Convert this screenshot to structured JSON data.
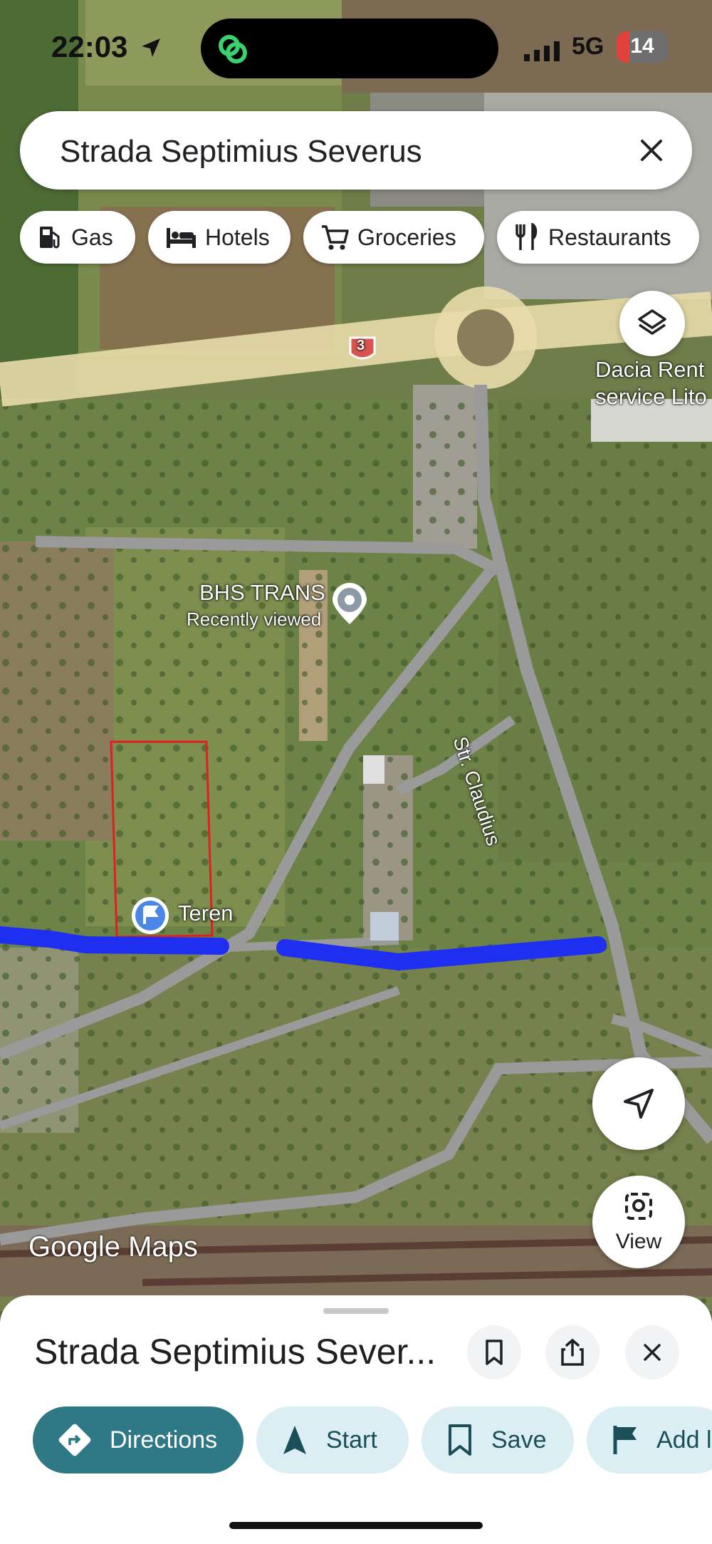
{
  "status_bar": {
    "time": "22:03",
    "network": "5G",
    "battery": "14"
  },
  "search": {
    "value": "Strada Septimius Severus"
  },
  "chips": [
    {
      "label": "Gas",
      "icon": "gas-station-icon"
    },
    {
      "label": "Hotels",
      "icon": "bed-icon"
    },
    {
      "label": "Groceries",
      "icon": "cart-icon"
    },
    {
      "label": "Restaurants",
      "icon": "fork-knife-icon"
    }
  ],
  "map": {
    "route_shield": "3",
    "business_label": "Dacia Rent service Lito",
    "poi": {
      "name": "BHS TRANS",
      "subtitle": "Recently viewed"
    },
    "street_label": "Str. Claudius",
    "marker_label": "Teren",
    "watermark_google": "Google",
    "watermark_maps": "Maps",
    "view_label": "View"
  },
  "sheet": {
    "title": "Strada Septimius Sever...",
    "actions": [
      "Directions",
      "Start",
      "Save",
      "Add l"
    ]
  },
  "colors": {
    "accent": "#2f7885",
    "route": "#1f2ff0",
    "parcel": "#e02020"
  }
}
